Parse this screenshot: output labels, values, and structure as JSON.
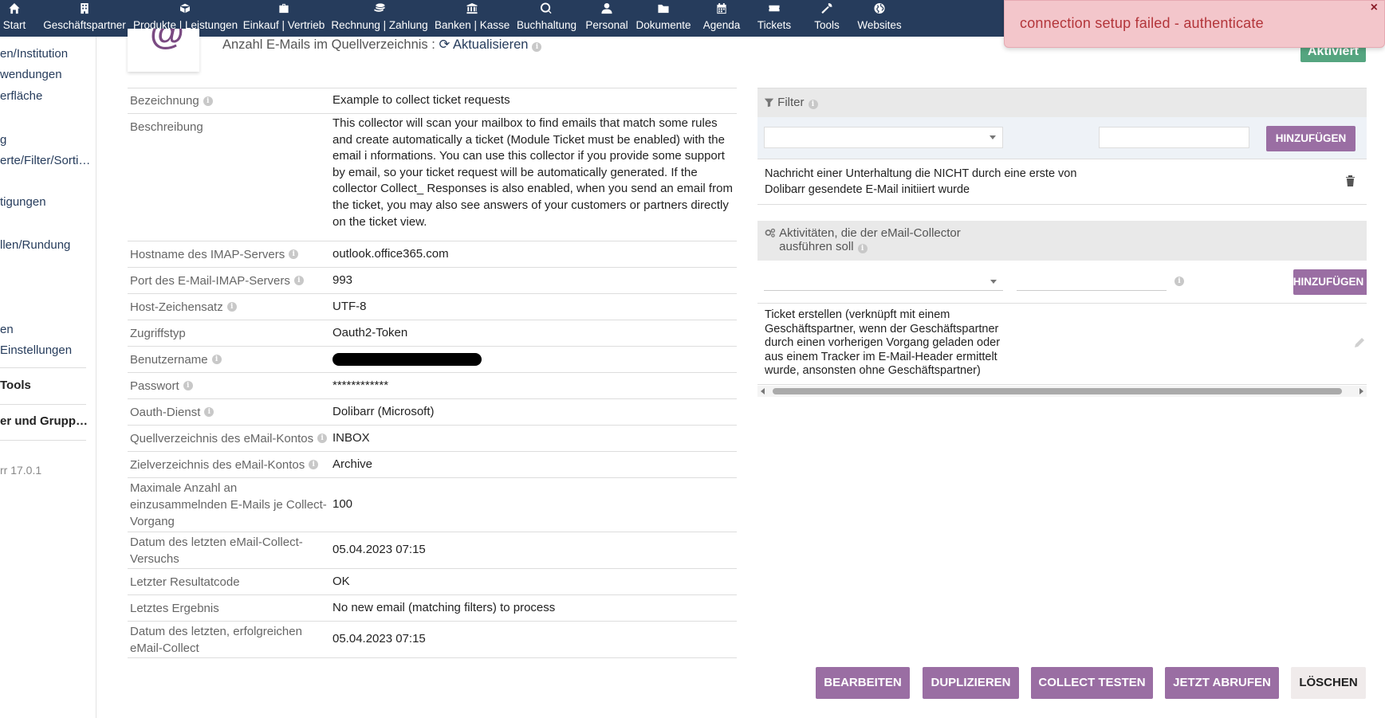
{
  "topnav": {
    "items": [
      {
        "label": "Start",
        "icon": "home-icon"
      },
      {
        "label": "Geschäftspartner",
        "icon": "building-icon"
      },
      {
        "label": "Produkte | Leistungen",
        "icon": "cube-icon"
      },
      {
        "label": "Einkauf | Vertrieb",
        "icon": "briefcase-icon"
      },
      {
        "label": "Rechnung | Zahlung",
        "icon": "coins-icon"
      },
      {
        "label": "Banken | Kasse",
        "icon": "bank-icon"
      },
      {
        "label": "Buchhaltung",
        "icon": "search-dollar-icon"
      },
      {
        "label": "Personal",
        "icon": "user-icon"
      },
      {
        "label": "Dokumente",
        "icon": "folder-icon"
      },
      {
        "label": "Agenda",
        "icon": "calendar-icon"
      },
      {
        "label": "Tickets",
        "icon": "ticket-icon"
      },
      {
        "label": "Tools",
        "icon": "wrench-icon"
      },
      {
        "label": "Websites",
        "icon": "globe-icon"
      }
    ]
  },
  "leftmenu": {
    "items": [
      {
        "label": "en/Institution"
      },
      {
        "label": "wendungen"
      },
      {
        "label": "erfläche"
      },
      {
        "label": "g"
      },
      {
        "label": "erte/Filter/Sorti…"
      },
      {
        "label": "tigungen"
      },
      {
        "label": "llen/Rundung"
      },
      {
        "label": "en"
      },
      {
        "label": "Einstellungen"
      },
      {
        "label": "Tools"
      },
      {
        "label": "er und Grupp…"
      },
      {
        "label": "rr 17.0.1"
      }
    ]
  },
  "header": {
    "logo_glyph": "@",
    "mails_count_label": "Anzahl E-Mails im Quellverzeichnis :",
    "refresh_label": "Aktualisieren",
    "status_label": "Aktiviert"
  },
  "params": [
    {
      "key": "Bezeichnung",
      "value": "Example to collect ticket requests",
      "info": true
    },
    {
      "key": "Beschreibung",
      "value": "This collector will scan your mailbox to find emails that match some rules and create automatically a ticket (Module Ticket must be enabled) with the email i nformations. You can use this collector if you provide some support by email, so your ticket request will be automatically generated. If the collector Collect_ Responses is also enabled, when you send an email from the ticket, you may also see answers of your customers or partners directly on the ticket view.",
      "info": false
    },
    {
      "key": "Hostname des IMAP-Servers",
      "value": "outlook.office365.com",
      "info": true
    },
    {
      "key": "Port des E-Mail-IMAP-Servers",
      "value": "993",
      "info": true
    },
    {
      "key": "Host-Zeichensatz",
      "value": "UTF-8",
      "info": true
    },
    {
      "key": "Zugriffstyp",
      "value": "Oauth2-Token",
      "info": false
    },
    {
      "key": "Benutzername",
      "value": "",
      "info": true,
      "redacted": true
    },
    {
      "key": "Passwort",
      "value": "************",
      "info": true
    },
    {
      "key": "Oauth-Dienst",
      "value": "Dolibarr (Microsoft)",
      "info": true
    },
    {
      "key": "Quellverzeichnis des eMail-Kontos",
      "value": "INBOX",
      "info": true
    },
    {
      "key": "Zielverzeichnis des eMail-Kontos",
      "value": "Archive",
      "info": true
    },
    {
      "key": "Maximale Anzahl an einzusammelnden E-Mails je Collect-Vorgang",
      "value": "100",
      "info": false
    },
    {
      "key": "Datum des letzten eMail-Collect-Versuchs",
      "value": "05.04.2023 07:15",
      "info": false
    },
    {
      "key": "Letzter Resultatcode",
      "value": "OK",
      "info": false
    },
    {
      "key": "Letztes Ergebnis",
      "value": "No new email (matching filters) to process",
      "info": false
    },
    {
      "key": "Datum des letzten, erfolgreichen eMail-Collect",
      "value": "05.04.2023 07:15",
      "info": false
    }
  ],
  "filter_panel": {
    "title": "Filter",
    "add_label": "HINZUFÜGEN",
    "item_text": "Nachricht einer Unterhaltung die NICHT durch eine erste von Dolibarr gesendete E-Mail initiiert wurde"
  },
  "actions_panel": {
    "title": "Aktivitäten, die der eMail-Collector ausführen soll",
    "add_label": "HINZUFÜGEN",
    "item_text": "Ticket erstellen (verknüpft mit einem Geschäftspartner, wenn der Geschäftspartner durch einen vorherigen Vorgang geladen oder aus einem Tracker im E-Mail-Header ermittelt wurde, ansonsten ohne Geschäftspartner)"
  },
  "buttons": {
    "edit": "BEARBEITEN",
    "duplicate": "DUPLIZIEREN",
    "test": "COLLECT TESTEN",
    "fetch": "JETZT ABRUFEN",
    "delete": "LÖSCHEN"
  },
  "toast": {
    "message": "connection setup failed - authenticate",
    "close": "×"
  },
  "colors": {
    "nav_bg": "#263c5c",
    "button_purple": "#9a6ea3",
    "status_green": "#55a580",
    "toast_bg": "#f3c6cb",
    "toast_text": "#b3353a"
  }
}
